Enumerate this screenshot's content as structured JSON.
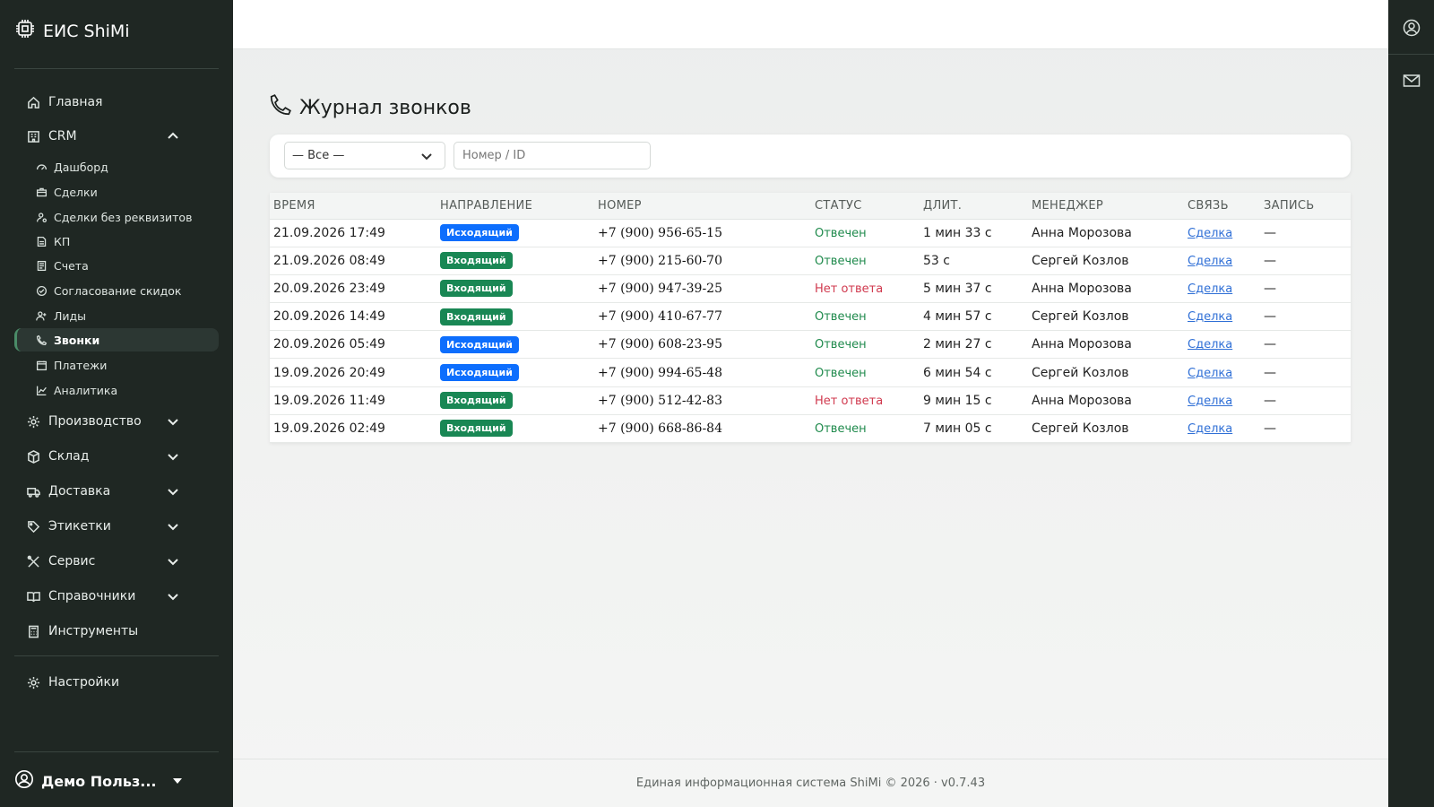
{
  "app": {
    "brand": "ЕИС ShiMi"
  },
  "sidebar": {
    "items": [
      {
        "label": "Главная",
        "icon": "home-icon"
      },
      {
        "label": "CRM",
        "icon": "building-icon",
        "expanded": true
      },
      {
        "label": "Производство",
        "icon": "gear-icon"
      },
      {
        "label": "Склад",
        "icon": "box-icon"
      },
      {
        "label": "Доставка",
        "icon": "truck-icon"
      },
      {
        "label": "Этикетки",
        "icon": "tag-icon"
      },
      {
        "label": "Сервис",
        "icon": "tools-icon"
      },
      {
        "label": "Справочники",
        "icon": "book-icon"
      },
      {
        "label": "Инструменты",
        "icon": "calculator-icon"
      },
      {
        "label": "Настройки",
        "icon": "gear-icon"
      }
    ],
    "crm_sub": [
      {
        "label": "Дашборд",
        "icon": "speedometer-icon"
      },
      {
        "label": "Сделки",
        "icon": "briefcase-icon"
      },
      {
        "label": "Сделки без реквизитов",
        "icon": "person-gear-icon"
      },
      {
        "label": "КП",
        "icon": "document-icon"
      },
      {
        "label": "Счета",
        "icon": "receipt-icon"
      },
      {
        "label": "Согласование скидок",
        "icon": "check-circle-icon"
      },
      {
        "label": "Лиды",
        "icon": "person-plus-icon"
      },
      {
        "label": "Звонки",
        "icon": "phone-icon",
        "active": true
      },
      {
        "label": "Платежи",
        "icon": "calendar-icon"
      },
      {
        "label": "Аналитика",
        "icon": "graph-icon"
      }
    ],
    "user": "Демо Польз..."
  },
  "page": {
    "title": "Журнал звонков",
    "filter_select": "— Все —",
    "search_placeholder": "Номер / ID"
  },
  "table": {
    "headers": [
      "ВРЕМЯ",
      "НАПРАВЛЕНИЕ",
      "НОМЕР",
      "СТАТУС",
      "ДЛИТ.",
      "МЕНЕДЖЕР",
      "СВЯЗЬ",
      "ЗАПИСЬ"
    ],
    "rows": [
      {
        "time": "21.09.2026 17:49",
        "direction": "Исходящий",
        "number": "+7 (900) 956-65-15",
        "status": "Отвечен",
        "duration": "1 мин 33 с",
        "manager": "Анна Морозова",
        "link": "Сделка",
        "record": "—"
      },
      {
        "time": "21.09.2026 08:49",
        "direction": "Входящий",
        "number": "+7 (900) 215-60-70",
        "status": "Отвечен",
        "duration": "53 с",
        "manager": "Сергей Козлов",
        "link": "Сделка",
        "record": "—"
      },
      {
        "time": "20.09.2026 23:49",
        "direction": "Входящий",
        "number": "+7 (900) 947-39-25",
        "status": "Нет ответа",
        "duration": "5 мин 37 с",
        "manager": "Анна Морозова",
        "link": "Сделка",
        "record": "—"
      },
      {
        "time": "20.09.2026 14:49",
        "direction": "Входящий",
        "number": "+7 (900) 410-67-77",
        "status": "Отвечен",
        "duration": "4 мин 57 с",
        "manager": "Сергей Козлов",
        "link": "Сделка",
        "record": "—"
      },
      {
        "time": "20.09.2026 05:49",
        "direction": "Исходящий",
        "number": "+7 (900) 608-23-95",
        "status": "Отвечен",
        "duration": "2 мин 27 с",
        "manager": "Анна Морозова",
        "link": "Сделка",
        "record": "—"
      },
      {
        "time": "19.09.2026 20:49",
        "direction": "Исходящий",
        "number": "+7 (900) 994-65-48",
        "status": "Отвечен",
        "duration": "6 мин 54 с",
        "manager": "Сергей Козлов",
        "link": "Сделка",
        "record": "—"
      },
      {
        "time": "19.09.2026 11:49",
        "direction": "Входящий",
        "number": "+7 (900) 512-42-83",
        "status": "Нет ответа",
        "duration": "9 мин 15 с",
        "manager": "Анна Морозова",
        "link": "Сделка",
        "record": "—"
      },
      {
        "time": "19.09.2026 02:49",
        "direction": "Входящий",
        "number": "+7 (900) 668-86-84",
        "status": "Отвечен",
        "duration": "7 мин 05 с",
        "manager": "Сергей Козлов",
        "link": "Сделка",
        "record": "—"
      }
    ]
  },
  "colors": {
    "outgoing": "#0d6efd",
    "incoming": "#198754",
    "answered": "#1f8a4c",
    "missed": "#d0394e",
    "sidebar_bg": "#1f2723"
  },
  "footer": {
    "text": "Единая информационная система ShiMi © 2026 · v0.7.43"
  }
}
